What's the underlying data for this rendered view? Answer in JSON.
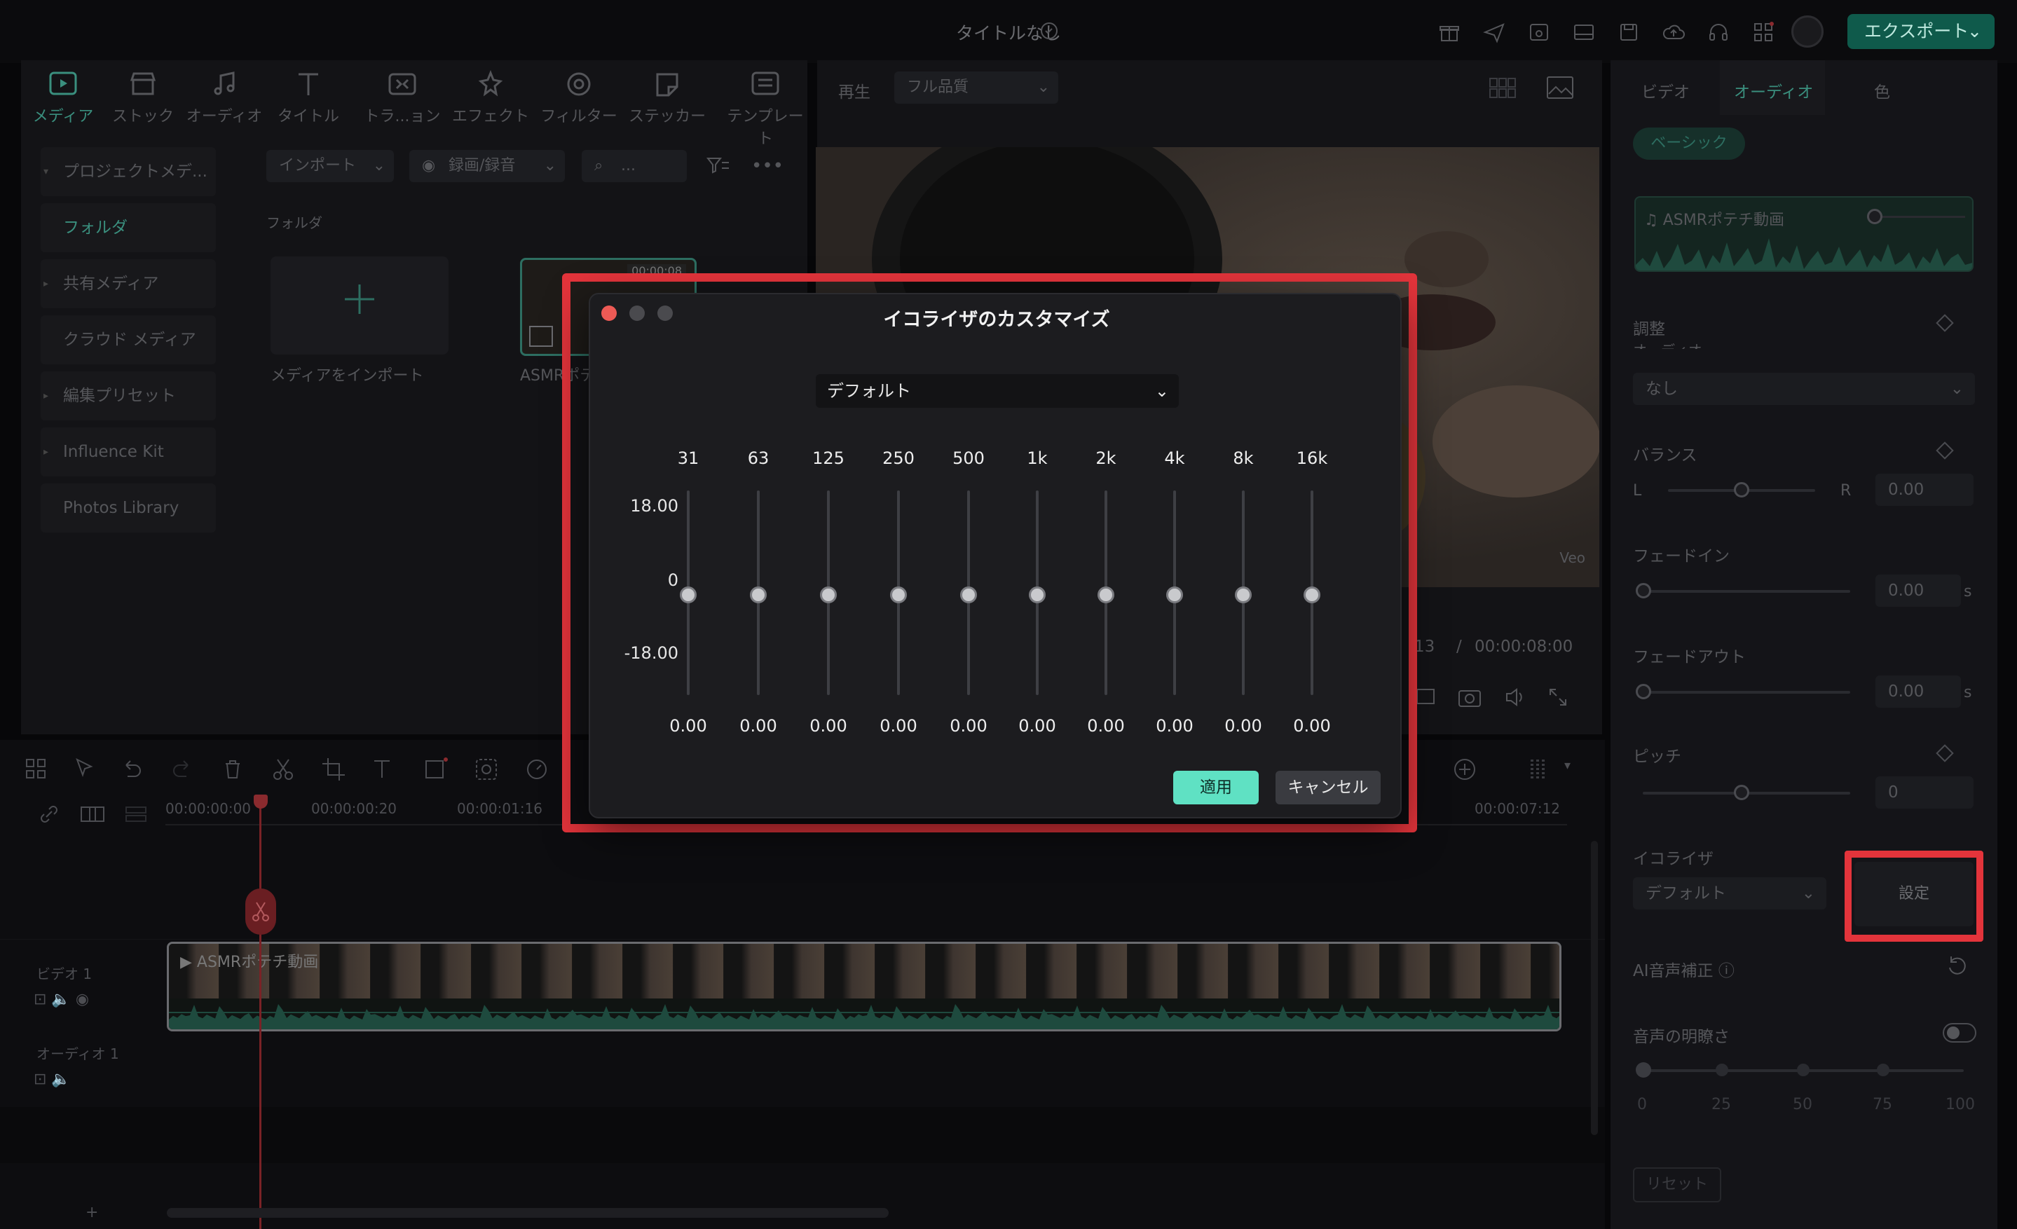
{
  "app": {
    "title": "タイトルなし",
    "export_label": "エクスポート"
  },
  "toolbar": [
    {
      "label": "メディア",
      "icon": "media-icon"
    },
    {
      "label": "ストック",
      "icon": "stock-icon"
    },
    {
      "label": "オーディオ",
      "icon": "music-note-icon"
    },
    {
      "label": "タイトル",
      "icon": "text-t-icon"
    },
    {
      "label": "トラ...ョン",
      "icon": "transition-icon"
    },
    {
      "label": "エフェクト",
      "icon": "effect-icon"
    },
    {
      "label": "フィルター",
      "icon": "filter-icon"
    },
    {
      "label": "ステッカー",
      "icon": "sticker-icon"
    },
    {
      "label": "テンプレート",
      "icon": "template-icon"
    }
  ],
  "sidebar": {
    "items": [
      {
        "label": "プロジェクトメデ...",
        "caret": true
      },
      {
        "label": "フォルダ",
        "caret": false,
        "active": true
      },
      {
        "label": "共有メディア",
        "caret": true
      },
      {
        "label": "クラウド メディア",
        "caret": false
      },
      {
        "label": "編集プリセット",
        "caret": true
      },
      {
        "label": "Influence Kit",
        "caret": true
      },
      {
        "label": "Photos Library",
        "caret": false
      }
    ]
  },
  "media": {
    "import_label": "インポート",
    "record_label": "録画/録音",
    "search_placeholder": "...",
    "folder_label": "フォルダ",
    "import_media_label": "メディアをインポート",
    "clip_name": "ASMRポテチ",
    "clip_duration": "00:00:08"
  },
  "preview": {
    "play_label": "再生",
    "quality": "フル品質",
    "current_time_partial": "13",
    "total_time": "00:00:08:00",
    "watermark": "Veo"
  },
  "inspector": {
    "tabs": [
      "ビデオ",
      "オーディオ",
      "色"
    ],
    "active_tab": 1,
    "basic_label": "ベーシック",
    "clip_name": "ASMRポテチ動画",
    "adjust_label": "調整",
    "partial_label": "オーディオ...",
    "none_value": "なし",
    "balance_label": "バランス",
    "balance_l": "L",
    "balance_r": "R",
    "balance_value": "0.00",
    "fade_in_label": "フェードイン",
    "fade_in_value": "0.00",
    "fade_out_label": "フェードアウト",
    "fade_out_value": "0.00",
    "unit_s": "s",
    "pitch_label": "ピッチ",
    "pitch_value": "0",
    "equalizer_label": "イコライザ",
    "equalizer_value": "デフォルト",
    "settings_label": "設定",
    "ai_label": "AI音声補正",
    "clarity_label": "音声の明瞭さ",
    "clarity_ticks": [
      "0",
      "25",
      "50",
      "75",
      "100"
    ],
    "reset_label": "リセット"
  },
  "timeline": {
    "ruler": [
      "00:00:00:00",
      "00:00:00:20",
      "00:00:01:16",
      "00:00:07:12"
    ],
    "video_track": "ビデオ 1",
    "audio_track": "オーディオ 1",
    "clip_label": "ASMRポテチ動画"
  },
  "dialog": {
    "title": "イコライザのカスタマイズ",
    "preset": "デフォルト",
    "db_max": "18.00",
    "db_mid": "0",
    "db_min": "-18.00",
    "bands": [
      {
        "freq": "31",
        "value": "0.00"
      },
      {
        "freq": "63",
        "value": "0.00"
      },
      {
        "freq": "125",
        "value": "0.00"
      },
      {
        "freq": "250",
        "value": "0.00"
      },
      {
        "freq": "500",
        "value": "0.00"
      },
      {
        "freq": "1k",
        "value": "0.00"
      },
      {
        "freq": "2k",
        "value": "0.00"
      },
      {
        "freq": "4k",
        "value": "0.00"
      },
      {
        "freq": "8k",
        "value": "0.00"
      },
      {
        "freq": "16k",
        "value": "0.00"
      }
    ],
    "apply_label": "適用",
    "cancel_label": "キャンセル"
  },
  "colors": {
    "accent": "#5fe1c3",
    "highlight": "#e3343b",
    "export": "#0f5a4b"
  }
}
